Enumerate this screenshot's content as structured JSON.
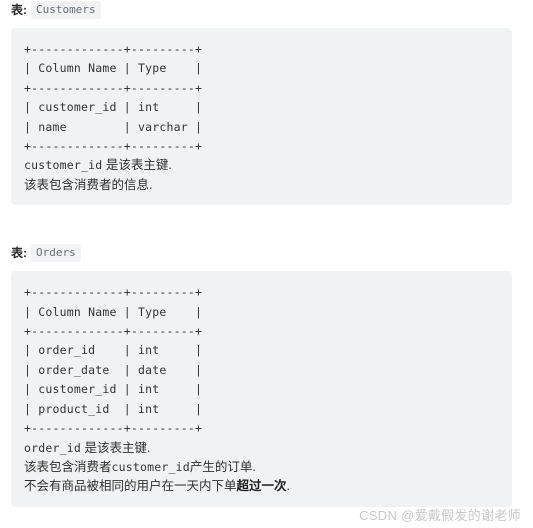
{
  "page": {
    "background": "#ffffff",
    "code_block_background": "#f1f2f3",
    "rule_color": "#a6833f",
    "text_color": "#333333",
    "watermark": "CSDN @爱戴假发的谢老师"
  },
  "sections": [
    {
      "caption_label": "表:",
      "caption_code": "Customers",
      "code_lines": [
        "+-------------+---------+",
        "| Column Name | Type    |",
        "+-------------+---------+",
        "| customer_id | int     |",
        "| name        | varchar |",
        "+-------------+---------+"
      ],
      "notes": [
        {
          "mono": "customer_id",
          "text": " 是该表主键."
        },
        {
          "mono": "",
          "text": "该表包含消费者的信息."
        }
      ]
    },
    {
      "caption_label": "表:",
      "caption_code": "Orders",
      "code_lines": [
        "+-------------+---------+",
        "| Column Name | Type    |",
        "+-------------+---------+",
        "| order_id    | int     |",
        "| order_date  | date    |",
        "| customer_id | int     |",
        "| product_id  | int     |",
        "+-------------+---------+"
      ],
      "notes": [
        {
          "mono": "order_id",
          "text": " 是该表主键."
        },
        {
          "prefix": "该表包含消费者",
          "mono": "customer_id",
          "text": "产生的订单."
        },
        {
          "prefix": "不会有商品被相同的用户在一天内下单",
          "bold": "超过一次",
          "text": "."
        }
      ]
    }
  ],
  "section0": {
    "caption_label": "表:",
    "caption_code": "Customers",
    "l0": "+-------------+---------+",
    "l1": "| Column Name | Type    |",
    "l2": "+-------------+---------+",
    "l3": "| customer_id | int     |",
    "l4": "| name        | varchar |",
    "l5": "+-------------+---------+",
    "n0_mono": "customer_id",
    "n0_text": " 是该表主键.",
    "n1_text": "该表包含消费者的信息."
  },
  "section1": {
    "caption_label": "表:",
    "caption_code": "Orders",
    "l0": "+-------------+---------+",
    "l1": "| Column Name | Type    |",
    "l2": "+-------------+---------+",
    "l3": "| order_id    | int     |",
    "l4": "| order_date  | date    |",
    "l5": "| customer_id | int     |",
    "l6": "| product_id  | int     |",
    "l7": "+-------------+---------+",
    "n0_mono": "order_id",
    "n0_text": " 是该表主键.",
    "n1_prefix": "该表包含消费者",
    "n1_mono": "customer_id",
    "n1_text": "产生的订单.",
    "n2_prefix": "不会有商品被相同的用户在一天内下单",
    "n2_bold": "超过一次",
    "n2_text": "."
  }
}
